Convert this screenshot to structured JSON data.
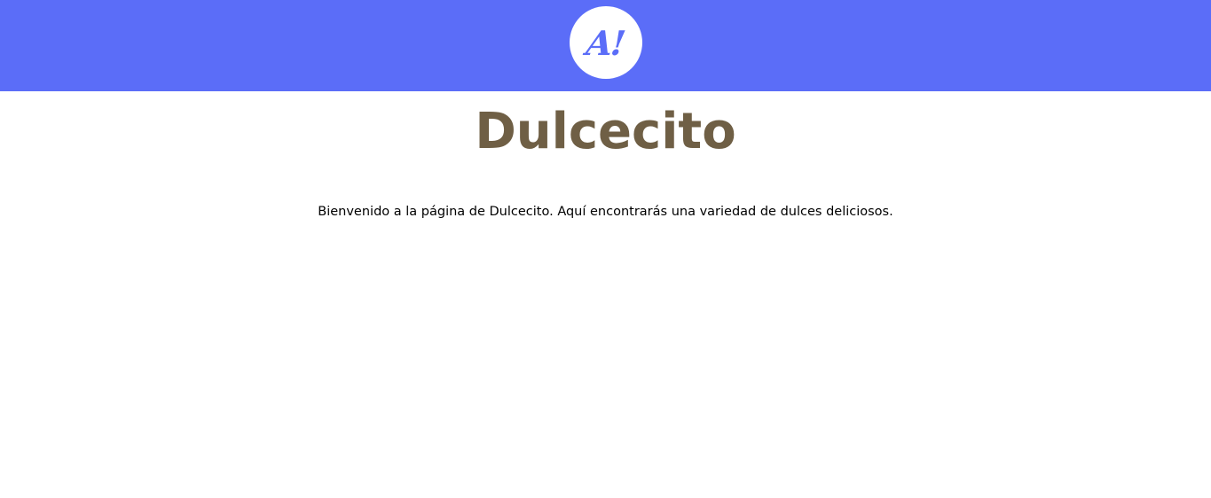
{
  "header": {
    "logo_text": "A!",
    "background_color": "#5b6df8",
    "logo_color": "#5b6df8"
  },
  "main": {
    "title": "Dulcecito",
    "title_color": "#6f5f45",
    "intro": "Bienvenido a la página de Dulcecito. Aquí encontrarás una variedad de dulces deliciosos."
  }
}
